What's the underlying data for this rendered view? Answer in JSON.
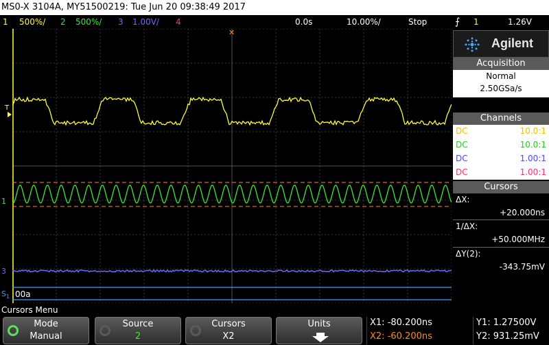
{
  "title": "MS0-X 3104A, MY51500219: Tue Jun 20 09:38:49 2017",
  "status": {
    "ch1_num": "1",
    "ch1_scale": "500%/",
    "ch2_num": "2",
    "ch2_scale": "500%/",
    "ch3_num": "3",
    "ch3_scale": "1.00V/",
    "ch4_num": "4",
    "time_offset": "0.0s",
    "timebase": "10.00%/",
    "run_state": "Stop",
    "trigger_symbol": "⨍",
    "trigger_source": "1",
    "trigger_level": "1.26V"
  },
  "colors": {
    "ch1": "#ffff33",
    "ch2": "#33ee33",
    "ch3": "#6b6bff",
    "ch4": "#ff3366",
    "cursor": "#ff8c1a",
    "grid": "#3c3c3c",
    "digital": "#3aa0ff"
  },
  "screen_labels": {
    "trigger_marker": "T",
    "ch1_marker": "1",
    "ch2_marker": "1",
    "ch3_marker": "3",
    "digital_label": "S",
    "digital_sub": "1",
    "digital_value": "00a"
  },
  "panel": {
    "brand": "Agilent",
    "acquisition": {
      "header": "Acquisition",
      "mode": "Normal",
      "rate": "2.50GSa/s"
    },
    "channels": {
      "header": "Channels",
      "rows": [
        {
          "coupling": "DC",
          "ratio": "10.0:1",
          "color": "#e8c400"
        },
        {
          "coupling": "DC",
          "ratio": "10.0:1",
          "color": "#22cc22"
        },
        {
          "coupling": "DC",
          "ratio": "1.00:1",
          "color": "#4646ff"
        },
        {
          "coupling": "DC",
          "ratio": "1.00:1",
          "color": "#ff2f6b"
        }
      ]
    },
    "cursors": {
      "header": "Cursors",
      "dx_label": "ΔX:",
      "dx_value": "+20.000ns",
      "inv_label": "1/ΔX:",
      "inv_value": "+50.000MHz",
      "dy_label": "ΔY(2):",
      "dy_value": "-343.75mV"
    }
  },
  "softkeys": {
    "menu_title": "Cursors Menu",
    "mode": {
      "title": "Mode",
      "value": "Manual"
    },
    "source": {
      "title": "Source",
      "value": "2"
    },
    "cursors": {
      "title": "Cursors",
      "value": "X2"
    },
    "units": {
      "title": "Units"
    }
  },
  "readouts": {
    "x1": "X1: -80.200ns",
    "x2": "X2: -60.200ns",
    "y1": "Y1: 1.27500V",
    "y2": "Y2: 931.25mV"
  }
}
